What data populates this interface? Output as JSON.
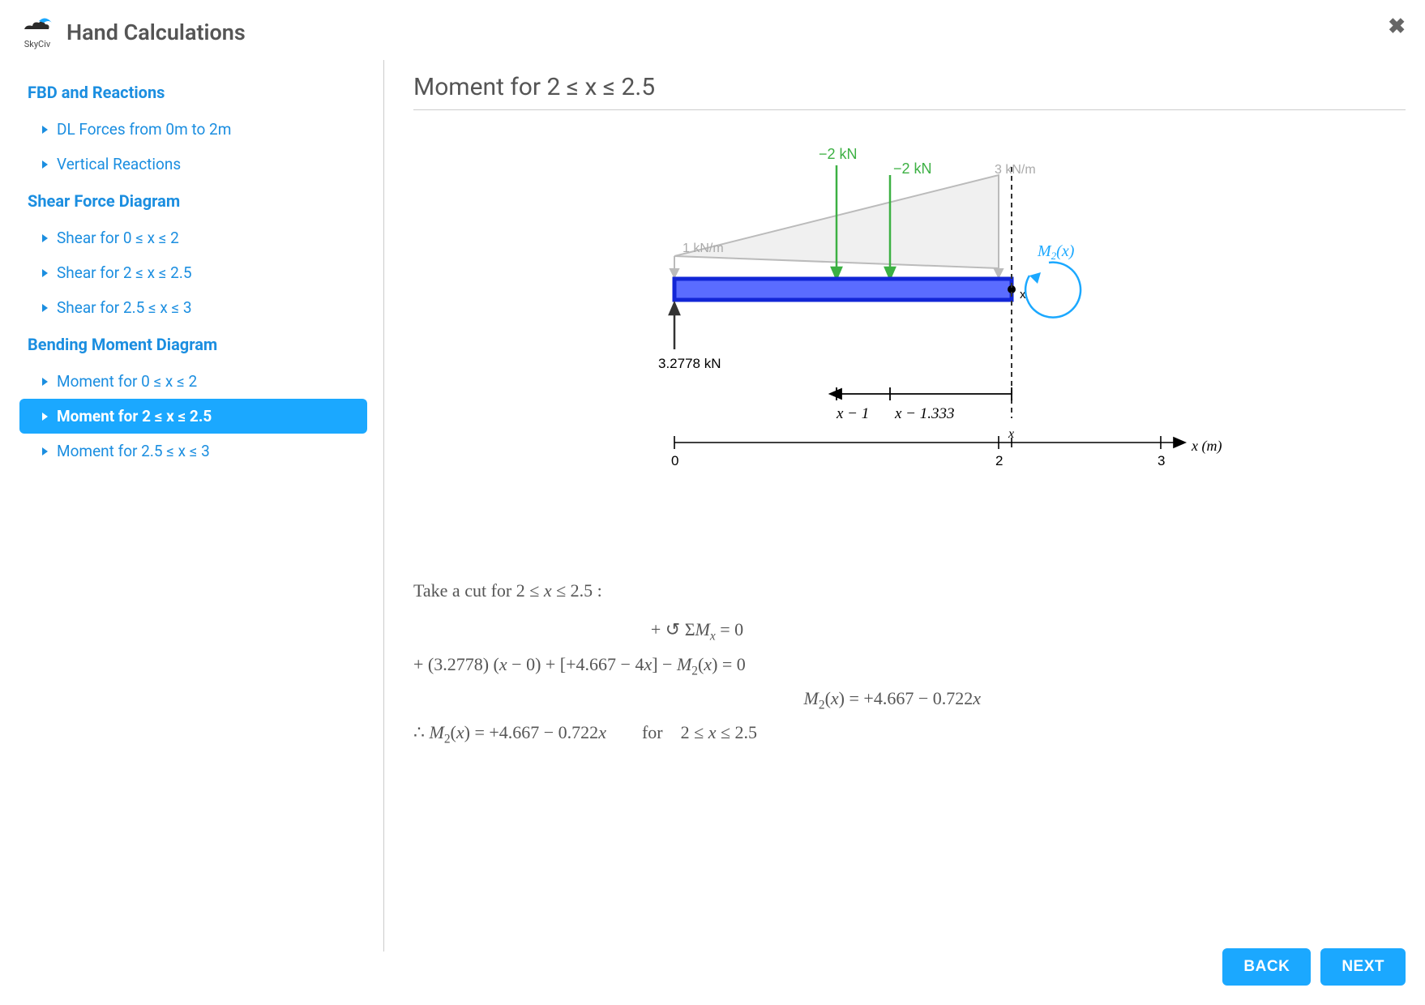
{
  "header": {
    "logo_text": "SkyCiv",
    "title": "Hand Calculations"
  },
  "sidebar": {
    "sections": [
      {
        "label": "FBD and Reactions",
        "items": [
          {
            "label": "DL Forces from 0m to 2m"
          },
          {
            "label": "Vertical Reactions"
          }
        ]
      },
      {
        "label": "Shear Force Diagram",
        "items": [
          {
            "label": "Shear for 0 ≤ x ≤ 2"
          },
          {
            "label": "Shear for 2 ≤ x ≤ 2.5"
          },
          {
            "label": "Shear for 2.5 ≤ x ≤ 3"
          }
        ]
      },
      {
        "label": "Bending Moment Diagram",
        "items": [
          {
            "label": "Moment for 0 ≤ x ≤ 2"
          },
          {
            "label": "Moment for 2 ≤ x ≤ 2.5",
            "active": true
          },
          {
            "label": "Moment for 2.5 ≤ x ≤ 3"
          }
        ]
      }
    ]
  },
  "main": {
    "title": "Moment for 2 ≤ x ≤ 2.5",
    "diagram": {
      "forces": {
        "point1": {
          "label": "−2 kN",
          "x": 1.0
        },
        "point2": {
          "label": "−2 kN",
          "x": 1.333
        },
        "dist_left": {
          "label": "1 kN/m",
          "x": 0
        },
        "dist_right": {
          "label": "3 kN/m",
          "x": 2.0
        },
        "reaction": {
          "label": "3.2778 kN",
          "x": 0
        }
      },
      "moment_label": "M₂(x)",
      "cut_position_label": "x",
      "dims": [
        {
          "label": "x − 1"
        },
        {
          "label": "x − 1.333"
        }
      ],
      "axis": {
        "ticks": [
          "0",
          "2",
          "3"
        ],
        "label": "x (m)",
        "symbol_tick": "x"
      }
    },
    "calc": {
      "intro": "Take a cut for 2 ≤ x ≤ 2.5 :",
      "lines": [
        "+ ↺ ΣMₓ = 0",
        "+ (3.2778) (x − 0) + [+4.667 − 4x] − M₂(x) = 0",
        "M₂(x) = +4.667 − 0.722x",
        "∴ M₂(x) = +4.667 − 0.722x   for   2 ≤ x ≤ 2.5"
      ]
    }
  },
  "footer": {
    "back": "BACK",
    "next": "NEXT"
  }
}
